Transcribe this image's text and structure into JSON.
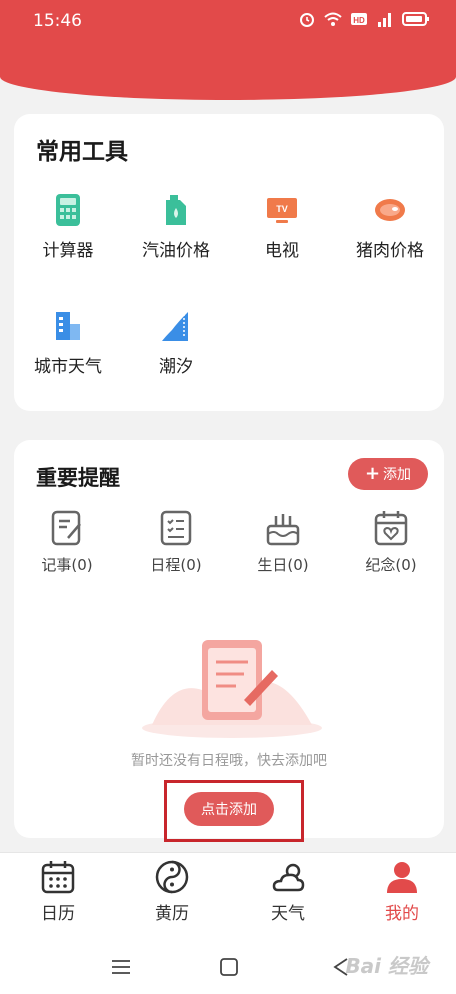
{
  "status_bar": {
    "time": "15:46",
    "icons": [
      "alarm-icon",
      "wifi-icon",
      "hd-icon",
      "signal-4g-icon",
      "battery-icon"
    ]
  },
  "tools_card": {
    "title": "常用工具",
    "items": [
      {
        "label": "计算器",
        "icon": "calculator-icon",
        "color": "#3bbf9a"
      },
      {
        "label": "汽油价格",
        "icon": "fuel-can-icon",
        "color": "#3bbf9a"
      },
      {
        "label": "电视",
        "icon": "tv-icon",
        "color": "#f07a4a"
      },
      {
        "label": "猪肉价格",
        "icon": "meat-icon",
        "color": "#f07a4a"
      },
      {
        "label": "城市天气",
        "icon": "city-weather-icon",
        "color": "#3a8ee6"
      },
      {
        "label": "潮汐",
        "icon": "tide-icon",
        "color": "#3a8ee6"
      }
    ]
  },
  "reminder_card": {
    "title": "重要提醒",
    "add_label": "添加",
    "items": [
      {
        "label": "记事(0)",
        "icon": "note-icon"
      },
      {
        "label": "日程(0)",
        "icon": "schedule-icon"
      },
      {
        "label": "生日(0)",
        "icon": "birthday-cake-icon"
      },
      {
        "label": "纪念(0)",
        "icon": "anniversary-icon"
      }
    ],
    "empty_text": "暂时还没有日程哦，快去添加吧",
    "cta_label": "点击添加"
  },
  "tabbar": {
    "tabs": [
      {
        "label": "日历",
        "icon": "calendar-icon",
        "active": false
      },
      {
        "label": "黄历",
        "icon": "yin-yang-icon",
        "active": false
      },
      {
        "label": "天气",
        "icon": "weather-icon",
        "active": false
      },
      {
        "label": "我的",
        "icon": "profile-icon",
        "active": true
      }
    ]
  },
  "accent_color": "#e24a4a",
  "watermark": "Bai 经验"
}
